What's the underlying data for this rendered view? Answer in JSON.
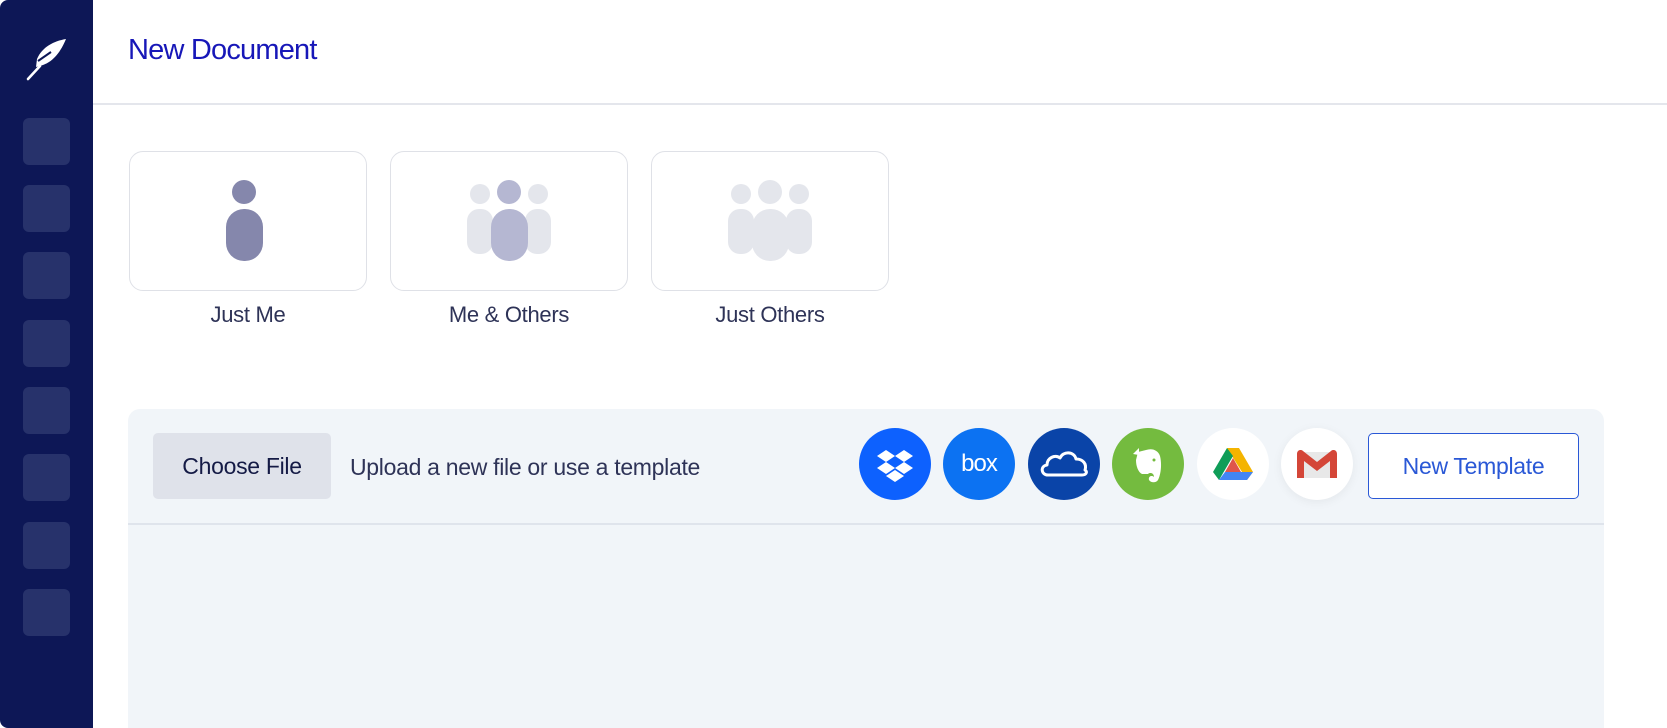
{
  "sidebar": {
    "logo_icon": "feather-icon",
    "nav_items": [
      "nav-slot-1",
      "nav-slot-2",
      "nav-slot-3",
      "nav-slot-4",
      "nav-slot-5",
      "nav-slot-6",
      "nav-slot-7",
      "nav-slot-8"
    ]
  },
  "header": {
    "title": "New Document"
  },
  "signer_options": [
    {
      "label": "Just Me",
      "icon": "single-person-icon"
    },
    {
      "label": "Me & Others",
      "icon": "group-with-me-icon"
    },
    {
      "label": "Just Others",
      "icon": "group-others-icon"
    }
  ],
  "upload": {
    "choose_file_label": "Choose File",
    "hint": "Upload a new file or use a template",
    "new_template_label": "New Template",
    "services": [
      {
        "name": "Dropbox",
        "icon": "dropbox-icon",
        "color": "#0d61fe"
      },
      {
        "name": "box",
        "icon": "box-icon",
        "color": "#0c72f2"
      },
      {
        "name": "OneDrive",
        "icon": "onedrive-icon",
        "color": "#0a44a8"
      },
      {
        "name": "Evernote",
        "icon": "evernote-icon",
        "color": "#74bb3f"
      },
      {
        "name": "Google Drive",
        "icon": "google-drive-icon",
        "color": "#ffffff"
      },
      {
        "name": "Gmail",
        "icon": "gmail-icon",
        "color": "#ffffff"
      }
    ]
  },
  "colors": {
    "sidebar_bg": "#0d1756",
    "accent": "#1717b8",
    "link_blue": "#2a58d6",
    "panel_bg": "#f1f5f9"
  }
}
